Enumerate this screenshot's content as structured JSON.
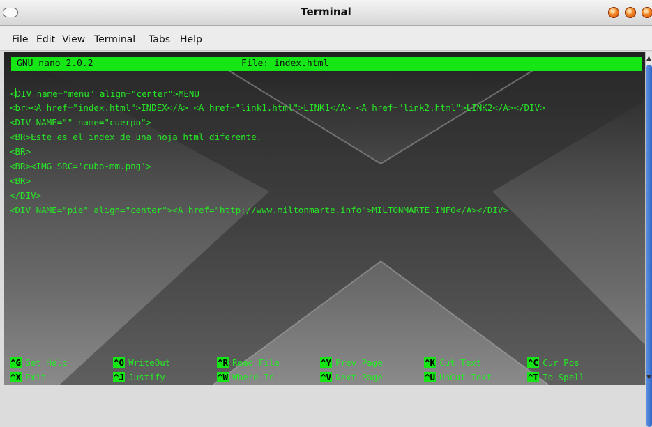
{
  "window": {
    "title": "Terminal"
  },
  "menu": [
    {
      "label": "File"
    },
    {
      "label": "Edit"
    },
    {
      "label": "View"
    },
    {
      "label": "Terminal"
    },
    {
      "label": "Tabs"
    },
    {
      "label": "Help"
    }
  ],
  "nano": {
    "version": "GNU nano 2.0.2",
    "file": "File: index.html",
    "lines": [
      "<DIV name=\"menu\" align=\"center\">MENU",
      "<br><A href=\"index.html\">INDEX</A> <A href=\"link1.html\">LINK1</A> <A href=\"link2.html\">LINK2</A></DIV>",
      "<DIV NAME=\"\" name=\"cuerpo\">",
      "<BR>Este es el index de una hoja html diferente.",
      "<BR>",
      "<BR><IMG SRC='cubo-mm.png'>",
      "<BR>",
      "</DIV>",
      "<DIV NAME=\"pie\" align=\"center\"><A href=\"http://www.miltonmarte.info\">MILTONMARTE.INFO</A></DIV>"
    ],
    "shortcuts": [
      [
        {
          "key": "^G",
          "label": "Get Help"
        },
        {
          "key": "^O",
          "label": "WriteOut"
        },
        {
          "key": "^R",
          "label": "Read File"
        },
        {
          "key": "^Y",
          "label": "Prev Page"
        },
        {
          "key": "^K",
          "label": "Cut Text"
        },
        {
          "key": "^C",
          "label": "Cur Pos"
        }
      ],
      [
        {
          "key": "^X",
          "label": "Exit"
        },
        {
          "key": "^J",
          "label": "Justify"
        },
        {
          "key": "^W",
          "label": "Where Is"
        },
        {
          "key": "^V",
          "label": "Next Page"
        },
        {
          "key": "^U",
          "label": "UnCut Text"
        },
        {
          "key": "^T",
          "label": "To Spell"
        }
      ]
    ]
  },
  "icons": {
    "window_menu": "window-menu-icon",
    "buttons": [
      "minimize-icon",
      "maximize-icon",
      "close-icon"
    ],
    "scroll_up": "scroll-up-icon",
    "scroll_down": "scroll-down-icon"
  },
  "colors": {
    "terminal_text": "#26e826",
    "status_bar": "#16e516",
    "window_buttons": "#f28a2c",
    "scrollbar_thumb": "#3a72d4"
  }
}
